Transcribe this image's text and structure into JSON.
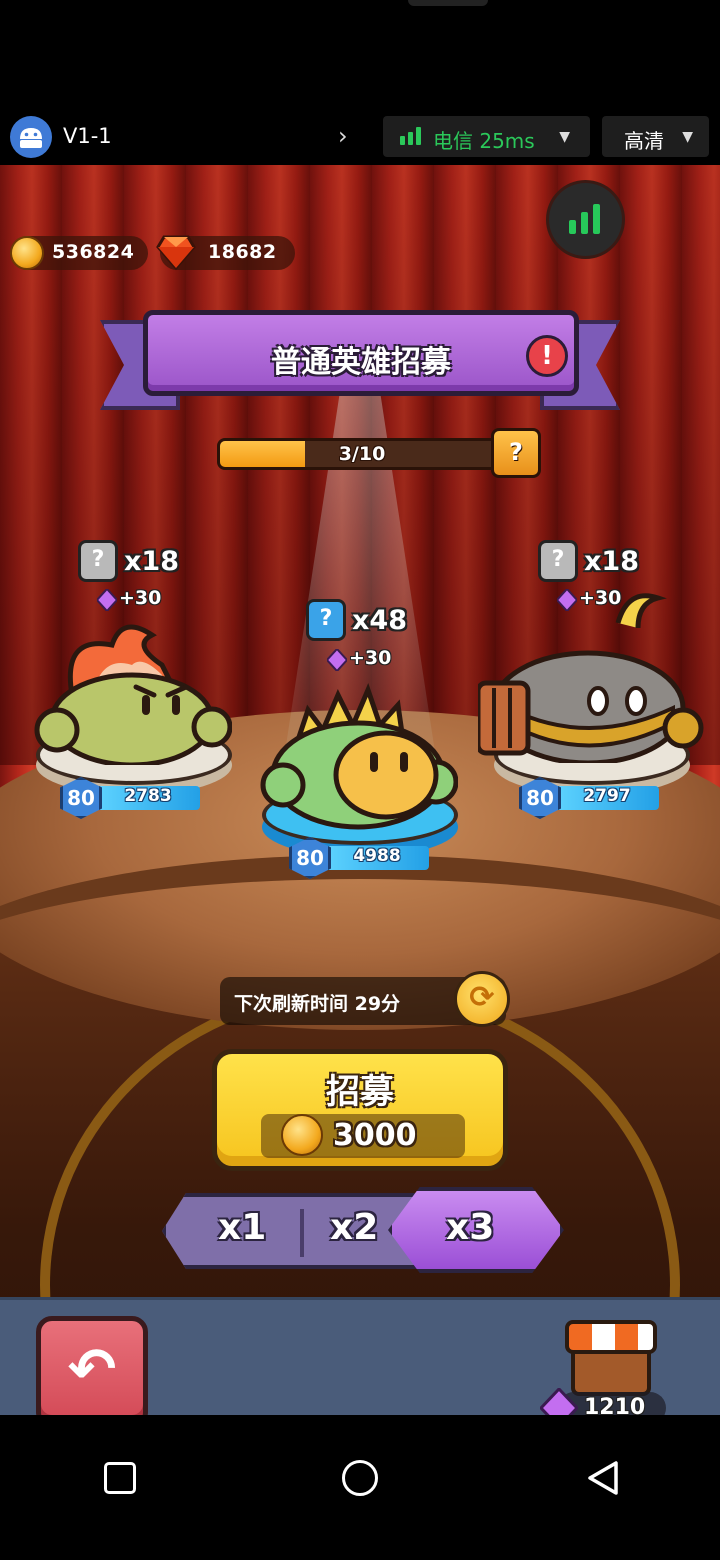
{
  "topbar": {
    "app_version": "V1-1",
    "network_label": "电信 25ms",
    "quality_label": "高清"
  },
  "currency": {
    "gold": "536824",
    "gems": "18682"
  },
  "banner": {
    "title": "普通英雄招募"
  },
  "progress": {
    "label": "3/10",
    "current": 3,
    "total": 10,
    "help_label": "?"
  },
  "heroes": [
    {
      "count": "x18",
      "bonus": "+30",
      "level": "80",
      "power": "2783",
      "rarity": "gray"
    },
    {
      "count": "x48",
      "bonus": "+30",
      "level": "80",
      "power": "4988",
      "rarity": "blue"
    },
    {
      "count": "x18",
      "bonus": "+30",
      "level": "80",
      "power": "2797",
      "rarity": "gray"
    }
  ],
  "refresh": {
    "label": "下次刷新时间 29分"
  },
  "recruit": {
    "title": "招募",
    "cost": "3000"
  },
  "multipliers": {
    "options": [
      "x1",
      "x2",
      "x3"
    ],
    "selected": "x3"
  },
  "shop": {
    "gems": "1210"
  },
  "colors": {
    "accent_purple": "#9b55c9",
    "gold": "#f6c41e",
    "network_green": "#2bc85a"
  }
}
